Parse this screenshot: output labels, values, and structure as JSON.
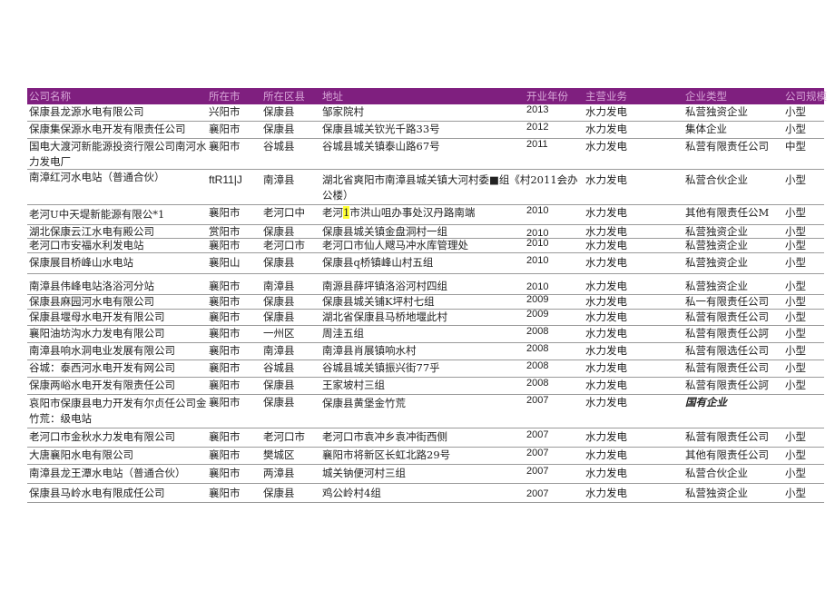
{
  "headers": {
    "name": "公司名称",
    "city": "所在市",
    "district": "所在区县",
    "address": "地址",
    "year": "开业年份",
    "business": "主营业务",
    "type": "企业类型",
    "size": "公司规模"
  },
  "rows": [
    {
      "name": "保康县龙源水电有限公司",
      "city": "兴阳市",
      "district": "保康县",
      "address": "邹家院村",
      "year": "2013",
      "business": "水力发电",
      "type": "私营独资企业",
      "size": "小型"
    },
    {
      "name": "保康集保源水电开发有限责任公司",
      "city": "襄阳市",
      "district": "保康县",
      "address": "保康县城关钦光千路33号",
      "year": "2012",
      "business": "水力发电",
      "type": "集体企业",
      "size": "小型"
    },
    {
      "name": "国电大渡河新能源投资行限公司南河水力发电厂",
      "city": "襄阳巿",
      "district": "谷城县",
      "address": "谷城县城关镇泰山路67号",
      "year": "2011",
      "business": "水力发电",
      "type": "私营有限责任公司",
      "size": "中型"
    },
    {
      "name": "南漳红河水电站（普通合伙）",
      "city": "ftR11|J",
      "district": "南漳县",
      "address": "湖北省爽阳市南漳县城关镇大河村委■组《村2011会办公楼）",
      "year": "",
      "business": "水力发电",
      "type": "私营合伙企业",
      "size": "小型"
    },
    {
      "name": "老河U中天堤新能源有限公*1",
      "city": "襄阳市",
      "district": "老河口中",
      "address_pre": "老河",
      "address_hl": "1",
      "address_post": "市洪山咀办事处汉丹路南端",
      "year": "2010",
      "business": "水力发电",
      "type": "其他有限责任公M",
      "size": "小型"
    },
    {
      "name": "湖北保康云江水电有殿公司",
      "city": "赏阳市",
      "district": "保康县",
      "address": "保康县城关镇金盘洞村一组",
      "year": "2010",
      "business": "水力发电",
      "type": "私营独资企业",
      "size": "小型"
    },
    {
      "name": "老河口市安福水利发电站",
      "city": "襄阳市",
      "district": "老河口市",
      "address": "老河口市仙人飕马冲水库管理处",
      "year": "2010",
      "business": "水力发电",
      "type": "私营独资企业",
      "size": "小型"
    },
    {
      "name": "保康展目桥峰山水电站",
      "city": "襄阳山",
      "district": "保康县",
      "address": "保康县q桥镇峰山村五组",
      "year": "2010",
      "business": "水力发电",
      "type": "私营独资企业",
      "size": "小型"
    },
    {
      "name": "南漳县伟峰电站洛浴河分站",
      "city": "襄阳市",
      "district": "南漳县",
      "address": "南源县薛坪镇洛浴河村四组",
      "year": "2010",
      "business": "水力发电",
      "type": "私营独资企业",
      "size": "小型"
    },
    {
      "name": "保康县麻园河水电有限公司",
      "city": "襄阳市",
      "district": "保康县",
      "address": "保康县城关铺K坪村七组",
      "year": "2009",
      "business": "水力发电",
      "type": "私一有限责任公司",
      "size": "小型"
    },
    {
      "name": "保康县堰母水电开发有限公司",
      "city": "襄阳市",
      "district": "保康县",
      "address": "湖北省保康县马桥地堰此村",
      "year": "2009",
      "business": "水力发电",
      "type": "私营有限责任公司",
      "size": "小型"
    },
    {
      "name": "襄阳油坊沟水力发电有限公司",
      "city": "襄阳市",
      "district": "一州区",
      "address": "周洼五组",
      "year": "2008",
      "business": "水力发电",
      "type": "私营有限责任公訶",
      "size": "小型"
    },
    {
      "name": "南漳县响水洞电业发展有限公司",
      "city": "襄阳市",
      "district": "南漳县",
      "address": "南漳县肖展镇响水村",
      "year": "2008",
      "business": "水力发电",
      "type": "私营有限选任公司",
      "size": "小型"
    },
    {
      "name": "谷城：泰西河水电开发有网公司",
      "city": "襄阳市",
      "district": "谷城县",
      "address": "谷城县城关镇振兴街77乎",
      "year": "2008",
      "business": "水力发电",
      "type": "私营有限责任公司",
      "size": "小型"
    },
    {
      "name": "保康两峪水电开发有限责任公司",
      "city": "襄阳市",
      "district": "保康县",
      "address": "王家坡村三组",
      "year": "2008",
      "business": "水力发电",
      "type": "私营有限责任公訶",
      "size": "小型"
    },
    {
      "name": "哀阳市保康县电力开发有尔贞任公司金竹荒：级电站",
      "city": "襄阳市",
      "district": "保康县",
      "address": "保康县黄堡金竹荒",
      "year": "2007",
      "business": "水力发电",
      "type": "国有企业",
      "size": ""
    },
    {
      "name": "老河口市金秋水力发电有限公司",
      "city": "襄阳市",
      "district": "老河口市",
      "address": "老河口市袁冲乡袁冲街西侧",
      "year": "2007",
      "business": "水力发电",
      "type": "私营有限责任公司",
      "size": "小型"
    },
    {
      "name": "大唐襄阳水电有限公司",
      "city": "襄阳市",
      "district": "樊城区",
      "address": "襄阳市将新区长虹北路29号",
      "year": "2007",
      "business": "水力发电",
      "type": "其他有限责任公司",
      "size": "小型"
    },
    {
      "name": "南漳县龙王潭水电站（普通合伙）",
      "city": "襄阳市",
      "district": "两漳县",
      "address": "城关钠便河村三组",
      "year": "2007",
      "business": "水力发电",
      "type": "私营合伙企业",
      "size": "小型"
    },
    {
      "name": "保康县马岭水电有限成任公司",
      "city": "襄阳市",
      "district": "保康县",
      "address": "鸡公岭村4组",
      "year": "2007",
      "business": "水力发电",
      "type": "私营独资企业",
      "size": "小型"
    }
  ]
}
